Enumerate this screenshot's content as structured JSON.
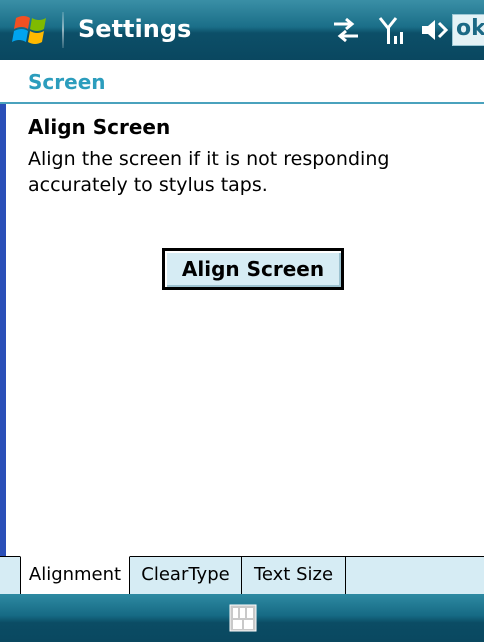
{
  "titlebar": {
    "title": "Settings",
    "ok_label": "ok",
    "icons": [
      "start-logo-icon",
      "connectivity-icon",
      "signal-icon",
      "volume-icon"
    ]
  },
  "header": {
    "title": "Screen"
  },
  "content": {
    "heading": "Align Screen",
    "description": "Align the screen if it is not responding accurately to stylus taps.",
    "button_label": "Align Screen"
  },
  "tabs": [
    {
      "label": "Alignment",
      "active": true
    },
    {
      "label": "ClearType",
      "active": false
    },
    {
      "label": "Text Size",
      "active": false
    }
  ],
  "bottombar": {
    "icons": [
      "keyboard-input-icon"
    ]
  },
  "colors": {
    "titlebar": "#1a6e88",
    "header_text": "#2c9dbd",
    "tab_background": "#d6ecf4",
    "left_edge": "#2a4fb8"
  }
}
